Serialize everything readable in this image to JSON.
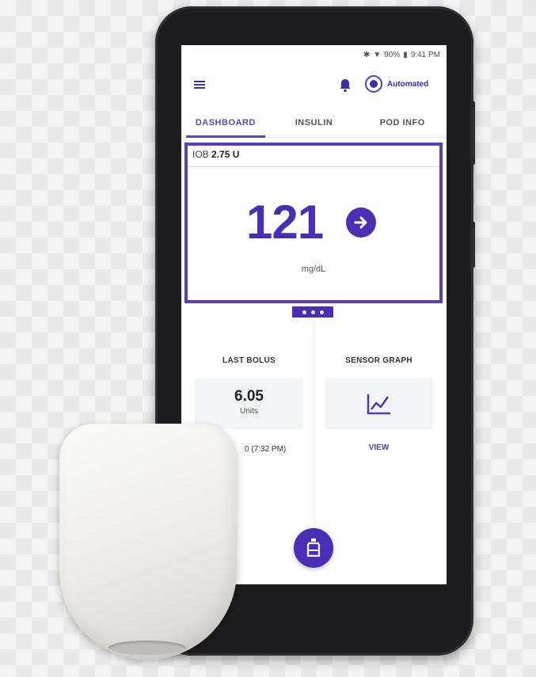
{
  "status_bar": {
    "battery": "90%",
    "time": "9:41 PM"
  },
  "app_bar": {
    "mode_label": "Automated"
  },
  "tabs": [
    {
      "label": "DASHBOARD",
      "active": true
    },
    {
      "label": "INSULIN",
      "active": false
    },
    {
      "label": "POD INFO",
      "active": false
    }
  ],
  "glucose": {
    "iob_label": "IOB",
    "iob_value": "2.75 U",
    "value": "121",
    "unit": "mg/dL",
    "trend_icon": "arrow-right-icon",
    "pager_dots": 3
  },
  "last_bolus": {
    "title": "LAST BOLUS",
    "value": "6.05",
    "unit": "Units",
    "time_partial": "0 (7:32 PM)"
  },
  "sensor_graph": {
    "title": "SENSOR GRAPH",
    "icon": "line-chart-icon",
    "link_label": "VIEW"
  },
  "fab": {
    "icon": "insulin-bolus-icon"
  },
  "colors": {
    "accent": "#4a2fb6",
    "card_border": "#5a3cc6",
    "phone_body": "#1d1d20"
  }
}
